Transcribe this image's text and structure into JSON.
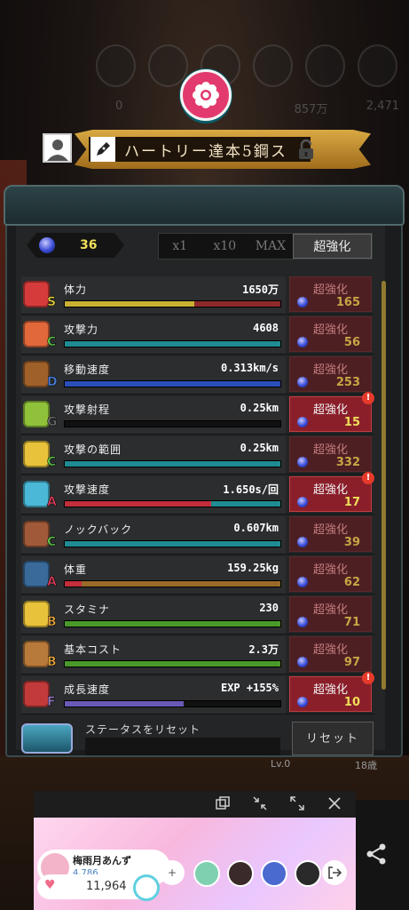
{
  "hud": {
    "stat_a": "0",
    "stat_b": "857万",
    "stat_c": "2,471",
    "level": "Lv.0",
    "age": "18歳"
  },
  "title": {
    "name": "ハートリー達本5鋼ス"
  },
  "gems": {
    "count": "36"
  },
  "multiplier_tabs": [
    "x1",
    "x10",
    "MAX",
    "超強化"
  ],
  "upgrade_label": "超強化",
  "stats": [
    {
      "name": "体力",
      "grade": "S",
      "grade_color": "#e8d23a",
      "value": "1650万",
      "cost": "165",
      "highlighted": false,
      "alert": false,
      "fill": 0.6,
      "bar_color": "#c9b232",
      "rest_color": "#8f2a2a",
      "icon": "heart-icon",
      "icon_color": "#d63b3b"
    },
    {
      "name": "攻撃力",
      "grade": "C",
      "grade_color": "#5fc24a",
      "value": "4608",
      "cost": "56",
      "highlighted": false,
      "alert": false,
      "fill": 1.0,
      "bar_color": "#1f8c93",
      "rest_color": "#1f8c93",
      "icon": "sword-icon",
      "icon_color": "#e0683a"
    },
    {
      "name": "移動速度",
      "grade": "D",
      "grade_color": "#4a7ed6",
      "value": "0.313km/s",
      "cost": "253",
      "highlighted": false,
      "alert": false,
      "fill": 1.0,
      "bar_color": "#2a4fb8",
      "rest_color": "#2a4fb8",
      "icon": "boot-icon",
      "icon_color": "#a0602a"
    },
    {
      "name": "攻撃射程",
      "grade": "G",
      "grade_color": "#6b6b6b",
      "value": "0.25km",
      "cost": "15",
      "highlighted": true,
      "alert": true,
      "fill": 0.0,
      "bar_color": "#333333",
      "rest_color": "#111111",
      "icon": "crossbow-icon",
      "icon_color": "#8fc23a"
    },
    {
      "name": "攻撃の範囲",
      "grade": "C",
      "grade_color": "#5fc24a",
      "value": "0.25km",
      "cost": "332",
      "highlighted": false,
      "alert": false,
      "fill": 1.0,
      "bar_color": "#1f8c93",
      "rest_color": "#1f8c93",
      "icon": "lightning-icon",
      "icon_color": "#e8c23a"
    },
    {
      "name": "攻撃速度",
      "grade": "A",
      "grade_color": "#d63b56",
      "value": "1.650s/回",
      "cost": "17",
      "highlighted": true,
      "alert": true,
      "fill": 0.68,
      "bar_color": "#c42d3a",
      "rest_color": "#1f8c93",
      "icon": "speed-blade-icon",
      "icon_color": "#4ab8d6"
    },
    {
      "name": "ノックバック",
      "grade": "C",
      "grade_color": "#5fc24a",
      "value": "0.607km",
      "cost": "39",
      "highlighted": false,
      "alert": false,
      "fill": 1.0,
      "bar_color": "#1f8c93",
      "rest_color": "#1f8c93",
      "icon": "fist-icon",
      "icon_color": "#a05a3a"
    },
    {
      "name": "体重",
      "grade": "A",
      "grade_color": "#d63b56",
      "value": "159.25kg",
      "cost": "62",
      "highlighted": false,
      "alert": false,
      "fill": 0.08,
      "bar_color": "#c42d3a",
      "rest_color": "#9a6a2a",
      "icon": "weight-icon",
      "icon_color": "#3a6a9a"
    },
    {
      "name": "スタミナ",
      "grade": "B",
      "grade_color": "#e8a23a",
      "value": "230",
      "cost": "71",
      "highlighted": false,
      "alert": false,
      "fill": 1.0,
      "bar_color": "#4a9a2a",
      "rest_color": "#4a9a2a",
      "icon": "heart-gold-icon",
      "icon_color": "#e8c23a"
    },
    {
      "name": "基本コスト",
      "grade": "B",
      "grade_color": "#e8a23a",
      "value": "2.3万",
      "cost": "97",
      "highlighted": false,
      "alert": false,
      "fill": 1.0,
      "bar_color": "#4a9a2a",
      "rest_color": "#4a9a2a",
      "icon": "coin-bag-icon",
      "icon_color": "#b87a3a"
    },
    {
      "name": "成長速度",
      "grade": "F",
      "grade_color": "#9a7ac2",
      "value": "EXP +155%",
      "cost": "10",
      "highlighted": true,
      "alert": true,
      "fill": 0.55,
      "bar_color": "#6a5ab8",
      "rest_color": "#111111",
      "icon": "growth-chart-icon",
      "icon_color": "#c23a3a"
    }
  ],
  "reset": {
    "label": "ステータスをリセット",
    "button": "リセット"
  },
  "stream": {
    "streamer_name": "梅雨月あんず",
    "fans": "4,786",
    "hearts": "11,964"
  }
}
